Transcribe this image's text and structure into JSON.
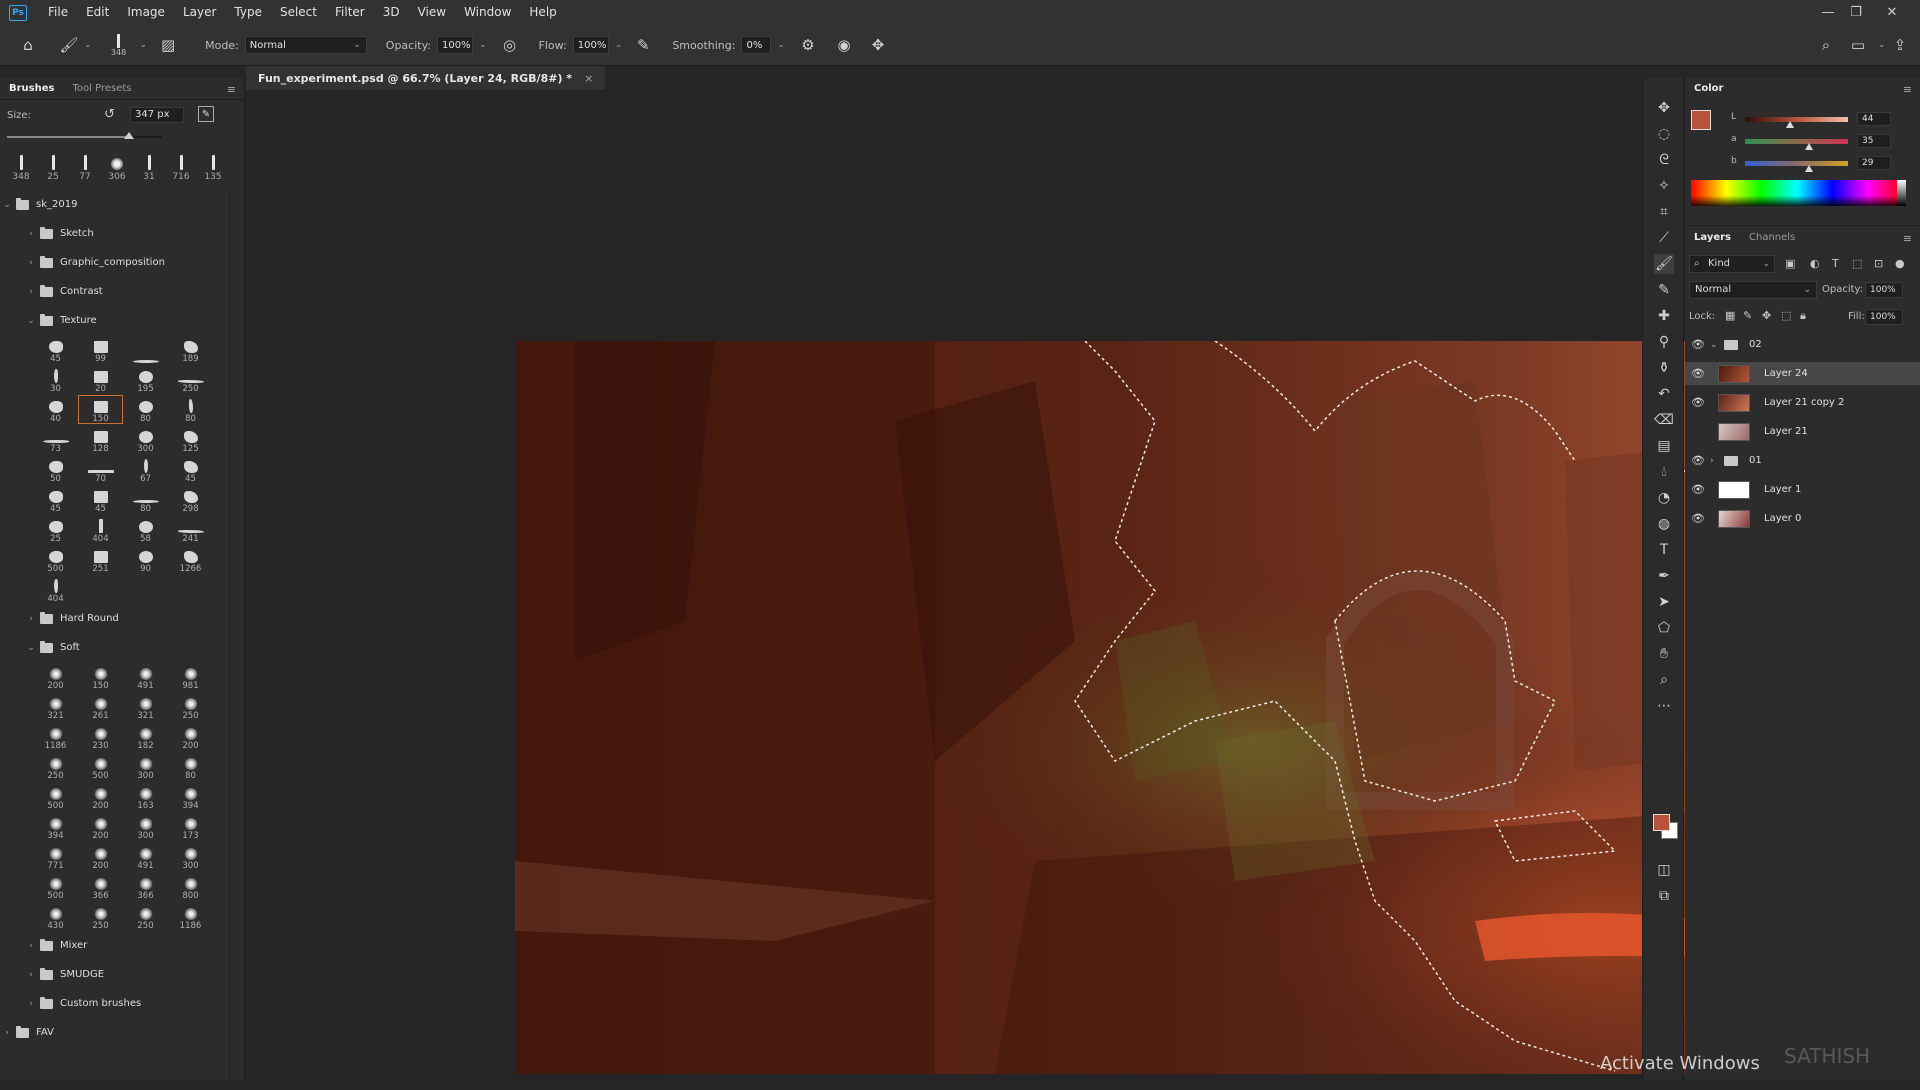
{
  "menubar": {
    "logo": "Ps",
    "items": [
      "File",
      "Edit",
      "Image",
      "Layer",
      "Type",
      "Select",
      "Filter",
      "3D",
      "View",
      "Window",
      "Help"
    ]
  },
  "options": {
    "brush_size": "348",
    "mode_label": "Mode:",
    "mode_value": "Normal",
    "opacity_label": "Opacity:",
    "opacity_value": "100%",
    "flow_label": "Flow:",
    "flow_value": "100%",
    "smoothing_label": "Smoothing:",
    "smoothing_value": "0%"
  },
  "brushes_panel": {
    "tabs": [
      "Brushes",
      "Tool Presets"
    ],
    "size_label": "Size:",
    "size_value": "347 px",
    "size_slider": 0.79,
    "recent_sizes": [
      "348",
      "25",
      "77",
      "306",
      "31",
      "716",
      "135"
    ],
    "root_folder": "sk_2019",
    "folders_before_texture": [
      "Sketch",
      "Graphic_composition",
      "Contrast"
    ],
    "texture_folder": "Texture",
    "texture_brushes": [
      "45",
      "99",
      "",
      "189",
      "30",
      "20",
      "195",
      "250",
      "40",
      "150",
      "80",
      "80",
      "73",
      "128",
      "300",
      "125",
      "50",
      "70",
      "67",
      "45",
      "45",
      "45",
      "80",
      "298",
      "25",
      "404",
      "58",
      "241",
      "500",
      "251",
      "90",
      "1266",
      "404"
    ],
    "hard_round_folder": "Hard Round",
    "soft_folder": "Soft",
    "soft_brushes": [
      "200",
      "150",
      "491",
      "981",
      "321",
      "261",
      "321",
      "250",
      "1186",
      "230",
      "182",
      "200",
      "250",
      "500",
      "300",
      "80",
      "500",
      "200",
      "163",
      "394",
      "394",
      "200",
      "300",
      "173",
      "771",
      "200",
      "491",
      "300",
      "500",
      "366",
      "366",
      "800",
      "430",
      "250",
      "250",
      "1186"
    ],
    "folders_after_soft": [
      "Mixer",
      "SMUDGE",
      "Custom brushes"
    ],
    "fav_folder": "FAV"
  },
  "document": {
    "tab_title": "Fun_experiment.psd @ 66.7% (Layer 24, RGB/8#) *",
    "close": "×"
  },
  "color_panel": {
    "title": "Color",
    "foreground": "#b8523a",
    "background": "#ffffff",
    "lab": [
      {
        "letter": "L",
        "value": "44",
        "pos": 0.44
      },
      {
        "letter": "a",
        "value": "35",
        "pos": 0.62
      },
      {
        "letter": "b",
        "value": "29",
        "pos": 0.62
      }
    ]
  },
  "layers_panel": {
    "tabs": [
      "Layers",
      "Channels"
    ],
    "kind_label": "Kind",
    "blend_mode": "Normal",
    "opacity_label": "Opacity:",
    "opacity_value": "100%",
    "lock_label": "Lock:",
    "fill_label": "Fill:",
    "fill_value": "100%",
    "layers": [
      {
        "name": "02",
        "type": "group",
        "visible": true,
        "selected": false
      },
      {
        "name": "Layer 24",
        "type": "layer",
        "visible": true,
        "selected": true
      },
      {
        "name": "Layer 21 copy 2",
        "type": "layer",
        "visible": true,
        "selected": false
      },
      {
        "name": "Layer 21",
        "type": "layer",
        "visible": false,
        "selected": false
      },
      {
        "name": "01",
        "type": "group",
        "visible": true,
        "selected": false
      },
      {
        "name": "Layer 1",
        "type": "layer",
        "visible": true,
        "selected": false
      },
      {
        "name": "Layer 0",
        "type": "layer",
        "visible": true,
        "selected": false
      }
    ]
  },
  "tools": [
    "move-icon",
    "marquee-icon",
    "lasso-icon",
    "magic-wand-icon",
    "crop-icon",
    "eyedropper-icon",
    "brush-icon",
    "pencil-icon",
    "healing-icon",
    "clone-stamp-icon",
    "stamp-icon",
    "history-brush-icon",
    "eraser-icon",
    "gradient-icon",
    "blur-icon",
    "dodge-icon",
    "sponge-icon",
    "type-icon",
    "pen-icon",
    "path-select-icon",
    "shape-icon",
    "hand-icon",
    "zoom-icon",
    "more-icon"
  ],
  "watermark": {
    "activate": "Activate Windows",
    "name": "SATHISH"
  }
}
